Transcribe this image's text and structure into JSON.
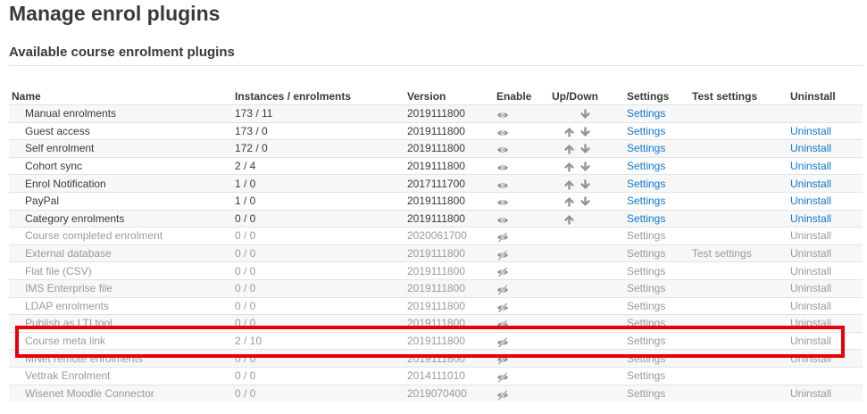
{
  "page": {
    "title": "Manage enrol plugins",
    "section_title": "Available course enrolment plugins"
  },
  "table": {
    "headers": {
      "name": "Name",
      "instances": "Instances / enrolments",
      "version": "Version",
      "enable": "Enable",
      "updown": "Up/Down",
      "settings": "Settings",
      "test_settings": "Test settings",
      "uninstall": "Uninstall"
    },
    "rows": [
      {
        "name": "Manual enrolments",
        "instances": "173 / 11",
        "version": "2019111800",
        "enabled": true,
        "up": false,
        "down": true,
        "settings": "Settings",
        "test_settings": "",
        "uninstall": ""
      },
      {
        "name": "Guest access",
        "instances": "173 / 0",
        "version": "2019111800",
        "enabled": true,
        "up": true,
        "down": true,
        "settings": "Settings",
        "test_settings": "",
        "uninstall": "Uninstall"
      },
      {
        "name": "Self enrolment",
        "instances": "172 / 0",
        "version": "2019111800",
        "enabled": true,
        "up": true,
        "down": true,
        "settings": "Settings",
        "test_settings": "",
        "uninstall": "Uninstall"
      },
      {
        "name": "Cohort sync",
        "instances": "2 / 4",
        "version": "2019111800",
        "enabled": true,
        "up": true,
        "down": true,
        "settings": "Settings",
        "test_settings": "",
        "uninstall": "Uninstall"
      },
      {
        "name": "Enrol Notification",
        "instances": "1 / 0",
        "version": "2017111700",
        "enabled": true,
        "up": true,
        "down": true,
        "settings": "Settings",
        "test_settings": "",
        "uninstall": "Uninstall"
      },
      {
        "name": "PayPal",
        "instances": "1 / 0",
        "version": "2019111800",
        "enabled": true,
        "up": true,
        "down": true,
        "settings": "Settings",
        "test_settings": "",
        "uninstall": "Uninstall"
      },
      {
        "name": "Category enrolments",
        "instances": "0 / 0",
        "version": "2019111800",
        "enabled": true,
        "up": true,
        "down": false,
        "settings": "Settings",
        "test_settings": "",
        "uninstall": "Uninstall"
      },
      {
        "name": "Course completed enrolment",
        "instances": "0 / 0",
        "version": "2020061700",
        "enabled": false,
        "up": false,
        "down": false,
        "settings": "Settings",
        "test_settings": "",
        "uninstall": "Uninstall"
      },
      {
        "name": "External database",
        "instances": "0 / 0",
        "version": "2019111800",
        "enabled": false,
        "up": false,
        "down": false,
        "settings": "Settings",
        "test_settings": "Test settings",
        "uninstall": "Uninstall"
      },
      {
        "name": "Flat file (CSV)",
        "instances": "0 / 0",
        "version": "2019111800",
        "enabled": false,
        "up": false,
        "down": false,
        "settings": "Settings",
        "test_settings": "",
        "uninstall": "Uninstall"
      },
      {
        "name": "IMS Enterprise file",
        "instances": "0 / 0",
        "version": "2019111800",
        "enabled": false,
        "up": false,
        "down": false,
        "settings": "Settings",
        "test_settings": "",
        "uninstall": "Uninstall"
      },
      {
        "name": "LDAP enrolments",
        "instances": "0 / 0",
        "version": "2019111800",
        "enabled": false,
        "up": false,
        "down": false,
        "settings": "Settings",
        "test_settings": "",
        "uninstall": "Uninstall"
      },
      {
        "name": "Publish as LTI tool",
        "instances": "0 / 0",
        "version": "2019111800",
        "enabled": false,
        "up": false,
        "down": false,
        "settings": "Settings",
        "test_settings": "",
        "uninstall": "Uninstall"
      },
      {
        "name": "Course meta link",
        "instances": "2 / 10",
        "version": "2019111800",
        "enabled": false,
        "up": false,
        "down": false,
        "settings": "Settings",
        "test_settings": "",
        "uninstall": "Uninstall"
      },
      {
        "name": "MNet remote enrolments",
        "instances": "0 / 0",
        "version": "2019111800",
        "enabled": false,
        "up": false,
        "down": false,
        "settings": "Settings",
        "test_settings": "",
        "uninstall": "Uninstall"
      },
      {
        "name": "Vettrak Enrolment",
        "instances": "0 / 0",
        "version": "2014111010",
        "enabled": false,
        "up": false,
        "down": false,
        "settings": "Settings",
        "test_settings": "",
        "uninstall": ""
      },
      {
        "name": "Wisenet Moodle Connector",
        "instances": "0 / 0",
        "version": "2019070400",
        "enabled": false,
        "up": false,
        "down": false,
        "settings": "Settings",
        "test_settings": "",
        "uninstall": "Uninstall"
      }
    ]
  },
  "highlight": {
    "target_row": "Course meta link",
    "color": "#e8000b"
  },
  "colors": {
    "link": "#1177d1",
    "disabled_text": "#9a9a9a",
    "icon": "#8f959e"
  },
  "icons": {
    "enabled": "eye-icon",
    "disabled": "eye-slash-icon",
    "up": "arrow-up-icon",
    "down": "arrow-down-icon"
  }
}
